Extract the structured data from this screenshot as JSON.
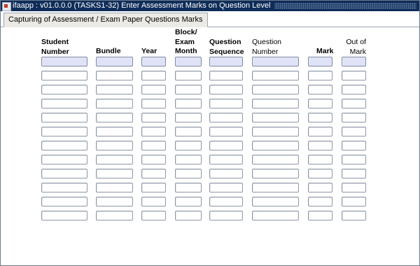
{
  "window": {
    "title": "ifaapp : v01.0.0.0 (TASKS1-32) Enter Assessment Marks on Question Level"
  },
  "tab": {
    "label": "Capturing of Assessment / Exam Paper Questions Marks"
  },
  "columns": [
    {
      "key": "student_number",
      "label": "Student\nNumber"
    },
    {
      "key": "bundle",
      "label": "Bundle"
    },
    {
      "key": "year",
      "label": "Year"
    },
    {
      "key": "block_exam_month",
      "label": "Block/\nExam\nMonth"
    },
    {
      "key": "question_sequence",
      "label": "Question\nSequence"
    },
    {
      "key": "question_number",
      "label": "Question\nNumber"
    },
    {
      "key": "mark",
      "label": "Mark"
    },
    {
      "key": "out_of_mark",
      "label": "Out of\nMark"
    }
  ],
  "rows_count_visible": 12,
  "colors": {
    "titlebar": "#0f2d59",
    "active_row_fill": "#e0e3f7",
    "field_border": "#8e98a6"
  }
}
